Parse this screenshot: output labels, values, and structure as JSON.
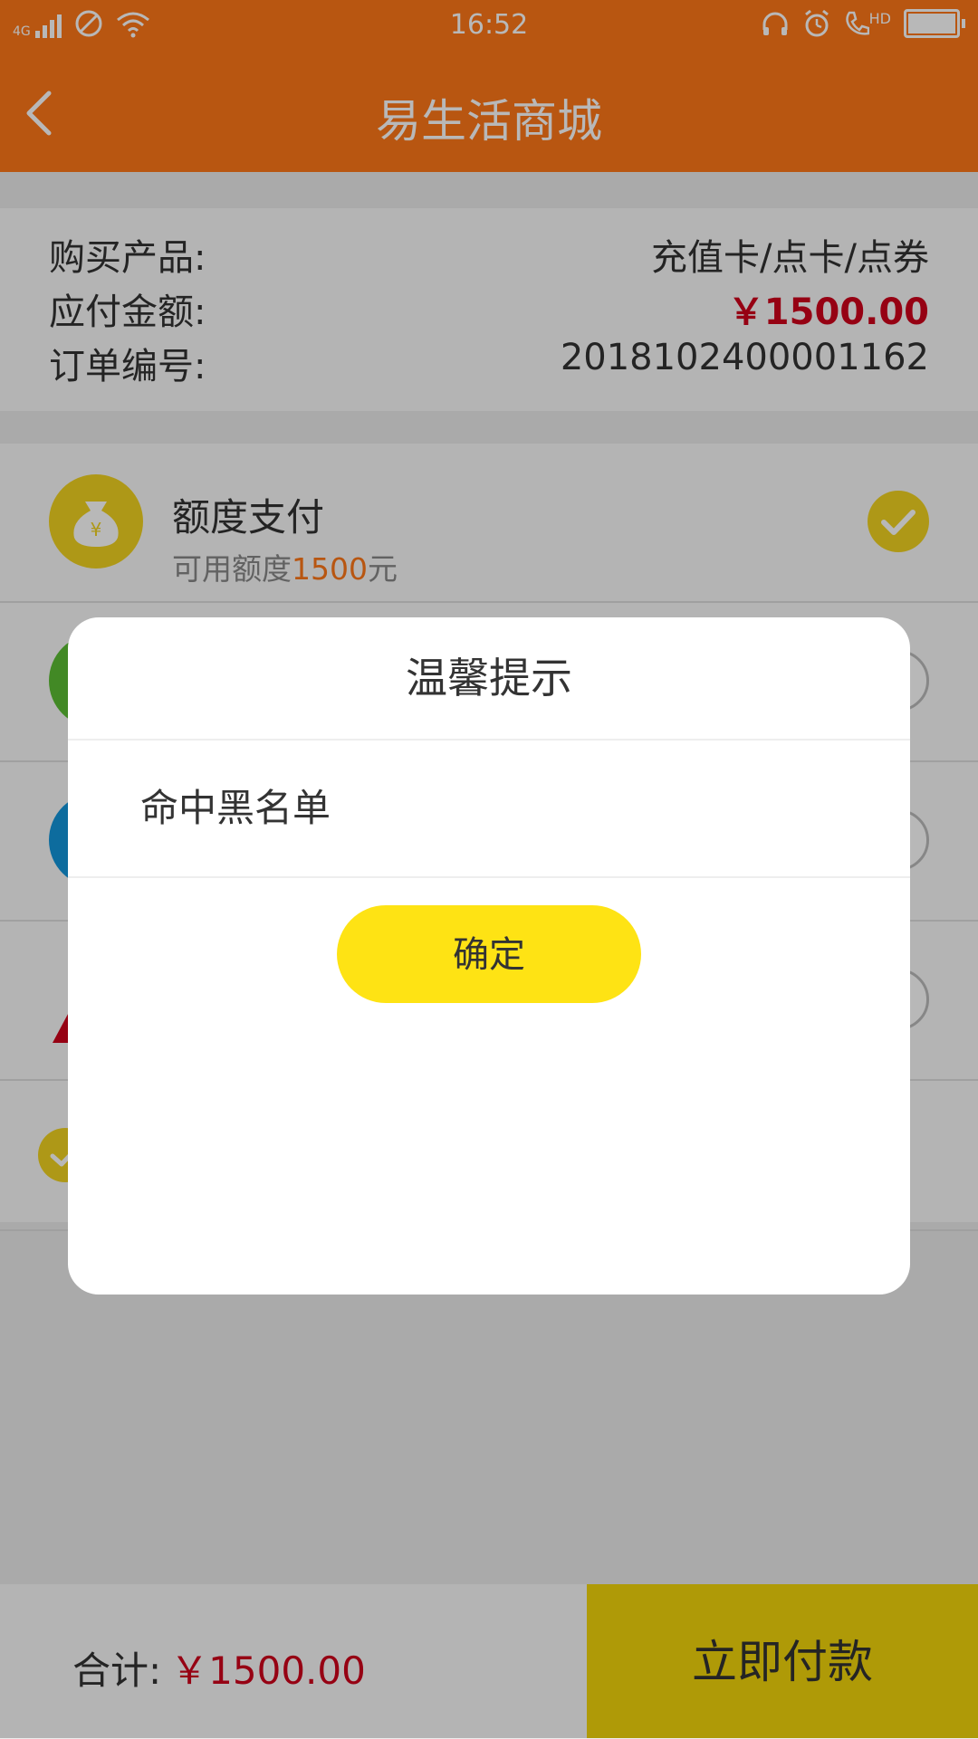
{
  "status_bar": {
    "time": "16:52",
    "network": "4G",
    "hd_label": "HD"
  },
  "app_bar": {
    "title": "易生活商城"
  },
  "order": {
    "product_label": "购买产品:",
    "product_value": "充值卡/点卡/点券",
    "amount_label": "应付金额:",
    "amount_value": "￥1500.00",
    "order_no_label": "订单编号:",
    "order_no_value": "2018102400001162"
  },
  "payment_options": [
    {
      "name": "额度支付",
      "sub_prefix": "可用额度",
      "sub_value": "1500",
      "sub_suffix": "元",
      "icon": "money-bag-icon",
      "icon_color": "#f2d321",
      "selected": true
    },
    {
      "name": "",
      "icon": "wechat-icon",
      "icon_color": "#5cbe34",
      "selected": false
    },
    {
      "name": "",
      "icon": "alipay-icon",
      "icon_color": "#1296db",
      "selected": false
    },
    {
      "name": "",
      "icon": "warning-icon",
      "icon_color": "#d0021b",
      "selected": false
    }
  ],
  "agreement": {
    "checked": true
  },
  "bottom_bar": {
    "total_label": "合计:",
    "total_value": "￥1500.00",
    "pay_button": "立即付款"
  },
  "dialog": {
    "title": "温馨提示",
    "message": "命中黑名单",
    "ok_button": "确定"
  },
  "colors": {
    "brand": "#ff7818",
    "accent_yellow": "#fee314",
    "price_red": "#d0021b"
  }
}
